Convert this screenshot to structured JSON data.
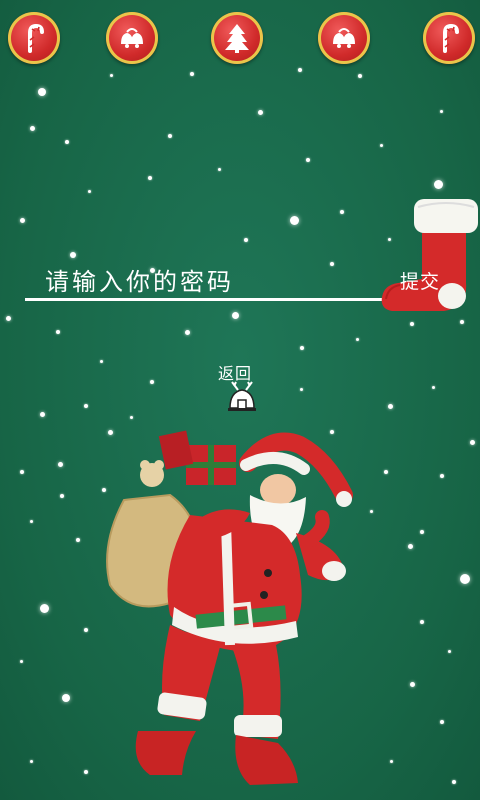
{
  "top_icons": [
    {
      "icon": "candy-cane-icon"
    },
    {
      "icon": "bells-icon"
    },
    {
      "icon": "christmas-tree-icon"
    },
    {
      "icon": "bells-icon"
    },
    {
      "icon": "candy-cane-icon"
    }
  ],
  "password": {
    "label": "请输入你的密码",
    "value": ""
  },
  "submit": {
    "label": "提交"
  },
  "back": {
    "label": "返回"
  },
  "colors": {
    "background": "#1a6b4e",
    "accent_red": "#d02a2a",
    "ring_gold": "#e9c64a",
    "text": "#ffffff"
  }
}
